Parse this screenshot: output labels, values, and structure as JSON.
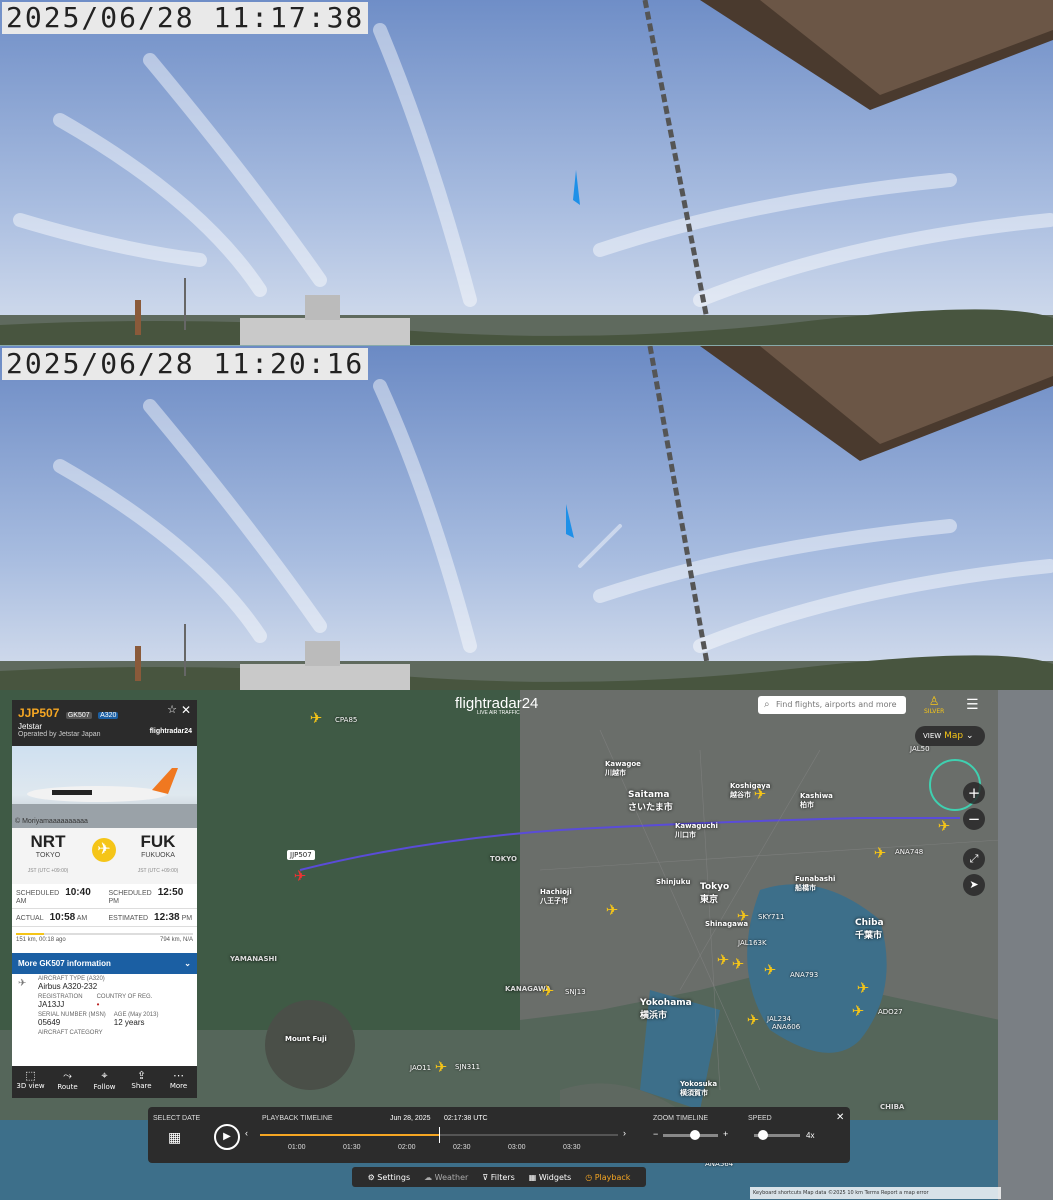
{
  "camera": {
    "frame1_timestamp": "2025/06/28 11:17:38",
    "frame2_timestamp": "2025/06/28 11:20:16"
  },
  "flight": {
    "callsign": "JJP507",
    "code_tag": "GK507",
    "type_tag": "A320",
    "airline": "Jetstar",
    "operator": "Operated by Jetstar Japan",
    "brand": "flightradar24",
    "photo_credit": "© Moriyamaaaaaaaaaa",
    "origin": {
      "code": "NRT",
      "city": "TOKYO",
      "tz": "JST (UTC +09:00)"
    },
    "destination": {
      "code": "FUK",
      "city": "FUKUOKA",
      "tz": "JST (UTC +09:00)"
    },
    "times": {
      "scheduled_dep_label": "SCHEDULED",
      "scheduled_dep": "10:40",
      "scheduled_dep_ampm": "AM",
      "scheduled_arr_label": "SCHEDULED",
      "scheduled_arr": "12:50",
      "scheduled_arr_ampm": "PM",
      "actual_dep_label": "ACTUAL",
      "actual_dep": "10:58",
      "actual_dep_ampm": "AM",
      "estimated_arr_label": "ESTIMATED",
      "estimated_arr": "12:38",
      "estimated_arr_ampm": "PM"
    },
    "progress_left": "151 km, 00:18 ago",
    "progress_right": "794 km, N/A",
    "progress_fraction": 0.16,
    "more_info": "More GK507 information",
    "aircraft_type_label": "AIRCRAFT TYPE (A320)",
    "aircraft_type": "Airbus A320-232",
    "registration_label": "REGISTRATION",
    "registration": "JA13JJ",
    "country_label": "COUNTRY OF REG.",
    "serial_label": "SERIAL NUMBER (MSN)",
    "serial": "05649",
    "age_label": "AGE (May 2013)",
    "age": "12 years",
    "category_label": "AIRCRAFT CATEGORY"
  },
  "panel_actions": [
    {
      "icon": "cube-icon",
      "label": "3D view"
    },
    {
      "icon": "route-icon",
      "label": "Route"
    },
    {
      "icon": "follow-icon",
      "label": "Follow"
    },
    {
      "icon": "share-icon",
      "label": "Share"
    },
    {
      "icon": "more-icon",
      "label": "More"
    }
  ],
  "map": {
    "logo": "flightradar24",
    "logo_sub": "LIVE AIR TRAFFIC",
    "search_placeholder": "Find flights, airports and more",
    "account_label": "SILVER",
    "view_label": "VIEW",
    "view_value": "Map",
    "flight_label": "JJP507",
    "cities": [
      {
        "name": "Saitama",
        "sub": "さいたま市"
      },
      {
        "name": "Tokyo",
        "sub": "東京"
      },
      {
        "name": "Yokohama",
        "sub": "横浜市"
      },
      {
        "name": "Chiba",
        "sub": "千葉市"
      },
      {
        "name": "Kawagoe",
        "sub": "川越市"
      },
      {
        "name": "Hachioji",
        "sub": "八王子市"
      },
      {
        "name": "Funabashi",
        "sub": "船橋市"
      },
      {
        "name": "Kawaguchi",
        "sub": "川口市"
      },
      {
        "name": "Koshigaya",
        "sub": "越谷市"
      },
      {
        "name": "Kashiwa",
        "sub": "柏市"
      },
      {
        "name": "Shinjuku",
        "sub": ""
      },
      {
        "name": "Shinagawa",
        "sub": ""
      },
      {
        "name": "Yokosuka",
        "sub": "横須賀市"
      },
      {
        "name": "Mount Fuji",
        "sub": ""
      },
      {
        "name": "KANAGAWA",
        "sub": ""
      },
      {
        "name": "TOKYO",
        "sub": ""
      },
      {
        "name": "CHIBA",
        "sub": ""
      },
      {
        "name": "YAMANASHI",
        "sub": ""
      }
    ],
    "flight_tags": [
      "JAL163K",
      "ANA793",
      "SKY711",
      "JAL234",
      "ANA606",
      "ANA748",
      "JAL50",
      "ADO27",
      "SNJ13",
      "JAO11",
      "SJN311",
      "ANA564",
      "CPA85"
    ],
    "footer": "Keyboard shortcuts   Map data ©2025   10 km   Terms   Report a map error"
  },
  "playback": {
    "select_date": "SELECT DATE",
    "timeline_label": "PLAYBACK TIMELINE",
    "date": "Jun 28, 2025",
    "time": "02:17:38",
    "tz": "UTC",
    "ticks": [
      "01:00",
      "01:30",
      "02:00",
      "02:30",
      "03:00",
      "03:30"
    ],
    "zoom_label": "ZOOM TIMELINE",
    "speed_label": "SPEED",
    "speed_value": "4x"
  },
  "bottom_menu": [
    "Settings",
    "Weather",
    "Filters",
    "Widgets",
    "Playback"
  ],
  "colors": {
    "accent": "#f5c518",
    "more_bar": "#1b5fa3",
    "playback_active": "#f5a623"
  }
}
